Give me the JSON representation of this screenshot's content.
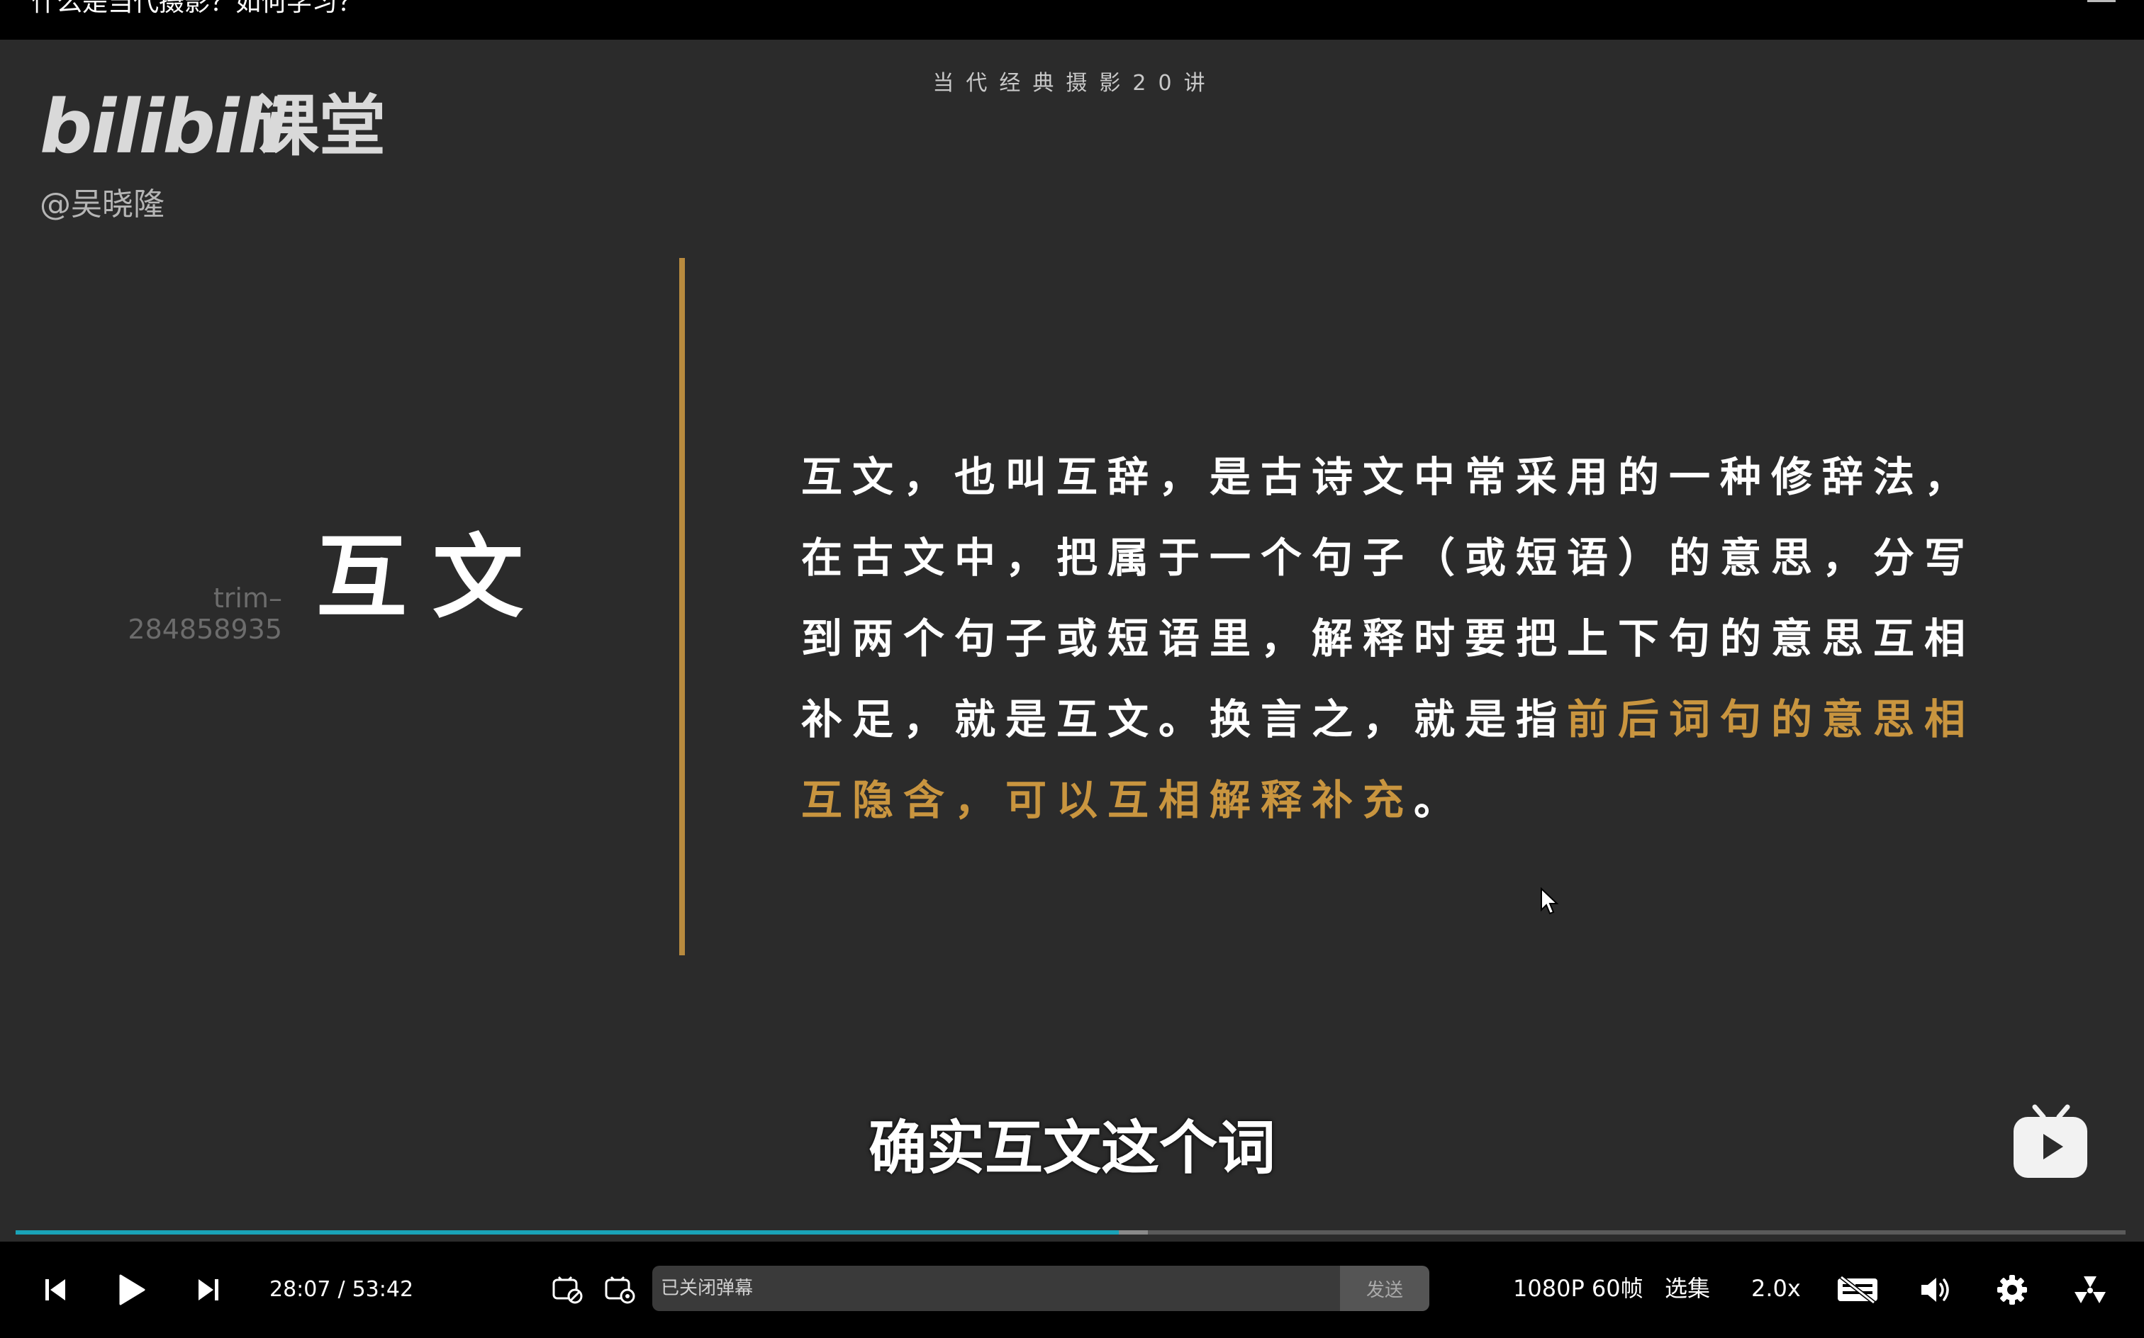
{
  "window": {
    "title": "什么是当代摄影？如何学习？"
  },
  "video": {
    "logo_text": "bilibili",
    "logo_cn": "课堂",
    "uploader": "@吴晓隆",
    "series_title": "当代经典摄影20讲",
    "watermark_line1": "trim–",
    "watermark_line2": "284858935",
    "concept": "互文",
    "definition_plain": "互文，也叫互辞，是古诗文中常采用的一种修辞法，在古文中，把属于一个句子（或短语）的意思，分写到两个句子或短语里，解释时要把上下句的意思互相补足，就是互文。换言之，就是指",
    "definition_highlight": "前后词句的意思相互隐含，可以互相解释补充",
    "definition_end": "。",
    "subtitle": "确实互文这个词",
    "accent_color": "#c9953f"
  },
  "player": {
    "progress_fraction": 0.5228,
    "buffer_fraction": 0.5367,
    "progress_color": "#1aa3b8",
    "current_time": "28:07",
    "separator": "/",
    "total_time": "53:42",
    "danmaku_placeholder": "已关闭弹幕",
    "send_label": "发送",
    "quality_label": "1080P 60帧",
    "episodes_label": "选集",
    "speed_label": "2.0x",
    "icons": [
      "prev-icon",
      "play-icon",
      "next-icon",
      "danmaku-toggle-icon",
      "danmaku-settings-icon",
      "subtitle-off-icon",
      "volume-icon",
      "settings-icon",
      "fullscreen-icon"
    ]
  }
}
